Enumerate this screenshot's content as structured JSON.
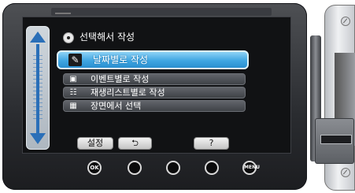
{
  "menu": {
    "title": "선택해서 작성",
    "selected_item": "날짜별로 작성",
    "items": [
      "이벤트별로 작성",
      "재생리스트별로 작성",
      "장면에서 선택"
    ]
  },
  "buttons": {
    "settings": "설정",
    "back": "⮌",
    "help": "?"
  },
  "hardware_buttons": {
    "ok": "OK",
    "menu": "MENU"
  },
  "colors": {
    "highlight": "#3fa6e2",
    "scroll_accent": "#2a6fb8"
  }
}
